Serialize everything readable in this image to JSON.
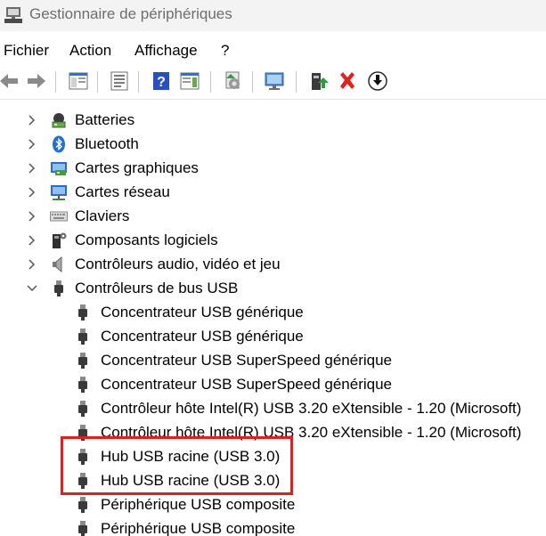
{
  "window": {
    "title": "Gestionnaire de périphériques"
  },
  "menu": [
    "Fichier",
    "Action",
    "Affichage",
    "?"
  ],
  "toolbar": {
    "buttons": [
      {
        "name": "back-button",
        "icon": "arrow-left-icon"
      },
      {
        "name": "forward-button",
        "icon": "arrow-right-icon"
      },
      {
        "name": "show-hide-console-tree-button",
        "icon": "console-tree-icon"
      },
      {
        "name": "properties-button",
        "icon": "properties-icon"
      },
      {
        "name": "help-button",
        "icon": "help-icon"
      },
      {
        "name": "action-pane-button",
        "icon": "action-pane-icon"
      },
      {
        "name": "update-driver-button",
        "icon": "update-driver-icon"
      },
      {
        "name": "scan-hardware-button",
        "icon": "monitor-scan-icon"
      },
      {
        "name": "add-driver-button",
        "icon": "add-driver-icon"
      },
      {
        "name": "uninstall-device-button",
        "icon": "red-x-icon"
      },
      {
        "name": "disable-device-button",
        "icon": "download-arrow-icon"
      }
    ],
    "accent_red": "#e0211d",
    "accent_blue": "#1e5bd6"
  },
  "tree": {
    "categories": [
      {
        "label": "Batteries",
        "icon": "battery-icon",
        "expanded": false
      },
      {
        "label": "Bluetooth",
        "icon": "bluetooth-icon",
        "expanded": false
      },
      {
        "label": "Cartes graphiques",
        "icon": "display-adapter-icon",
        "expanded": false
      },
      {
        "label": "Cartes réseau",
        "icon": "network-adapter-icon",
        "expanded": false
      },
      {
        "label": "Claviers",
        "icon": "keyboard-icon",
        "expanded": false
      },
      {
        "label": "Composants logiciels",
        "icon": "software-component-icon",
        "expanded": false
      },
      {
        "label": "Contrôleurs audio, vidéo et jeu",
        "icon": "speaker-icon",
        "expanded": false
      },
      {
        "label": "Contrôleurs de bus USB",
        "icon": "usb-plug-icon",
        "expanded": true
      }
    ],
    "usb_devices": [
      "Concentrateur USB générique",
      "Concentrateur USB générique",
      "Concentrateur USB SuperSpeed générique",
      "Concentrateur USB SuperSpeed générique",
      "Contrôleur hôte Intel(R) USB 3.20 eXtensible - 1.20 (Microsoft)",
      "Contrôleur hôte Intel(R) USB 3.20 eXtensible - 1.20 (Microsoft)",
      "Hub USB racine (USB 3.0)",
      "Hub USB racine (USB 3.0)",
      "Périphérique USB composite",
      "Périphérique USB composite"
    ],
    "highlight_color": "#e02020"
  }
}
